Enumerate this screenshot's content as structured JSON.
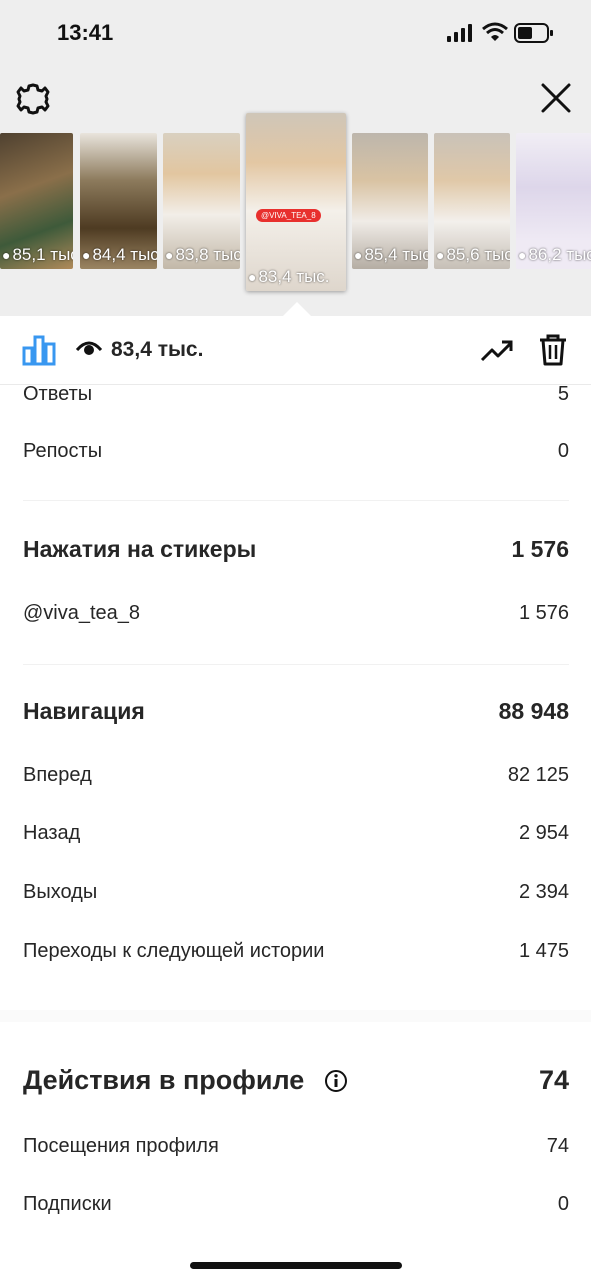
{
  "status_bar": {
    "time": "13:41"
  },
  "thumbnails": [
    {
      "views": "85,1 тыс.",
      "selected": false,
      "bg": "#5b4a35"
    },
    {
      "views": "84,4 тыс.",
      "selected": false,
      "bg": "#7a6a4d"
    },
    {
      "views": "83,8 тыс.",
      "selected": false,
      "bg": "#cdbfa9"
    },
    {
      "views": "83,4 тыс.",
      "selected": true,
      "bg": "#d8cfc2",
      "tag": "@VIVA_TEA_8"
    },
    {
      "views": "85,4 тыс.",
      "selected": false,
      "bg": "#c7c2bb"
    },
    {
      "views": "85,6 тыс.",
      "selected": false,
      "bg": "#cfc8c0"
    },
    {
      "views": "86,2 тыс.",
      "selected": false,
      "bg": "#e8e3ee"
    }
  ],
  "toolbar": {
    "views": "83,4 тыс."
  },
  "stats": {
    "replies": {
      "label": "Ответы",
      "value": "5"
    },
    "reposts": {
      "label": "Репосты",
      "value": "0"
    },
    "sticker_taps": {
      "label": "Нажатия на стикеры",
      "value": "1 576"
    },
    "sticker_item": {
      "label": "@viva_tea_8",
      "value": "1 576"
    },
    "navigation": {
      "label": "Навигация",
      "value": "88 948"
    },
    "forward": {
      "label": "Вперед",
      "value": "82 125"
    },
    "back": {
      "label": "Назад",
      "value": "2 954"
    },
    "exits": {
      "label": "Выходы",
      "value": "2 394"
    },
    "next_story": {
      "label": "Переходы к следующей истории",
      "value": "1 475"
    },
    "profile_actions": {
      "label": "Действия в профиле",
      "value": "74"
    },
    "profile_visits": {
      "label": "Посещения профиля",
      "value": "74"
    },
    "follows": {
      "label": "Подписки",
      "value": "0"
    }
  },
  "colors": {
    "accent": "#3897f0",
    "background": "#ffffff",
    "header_bg": "#eeeeee"
  }
}
